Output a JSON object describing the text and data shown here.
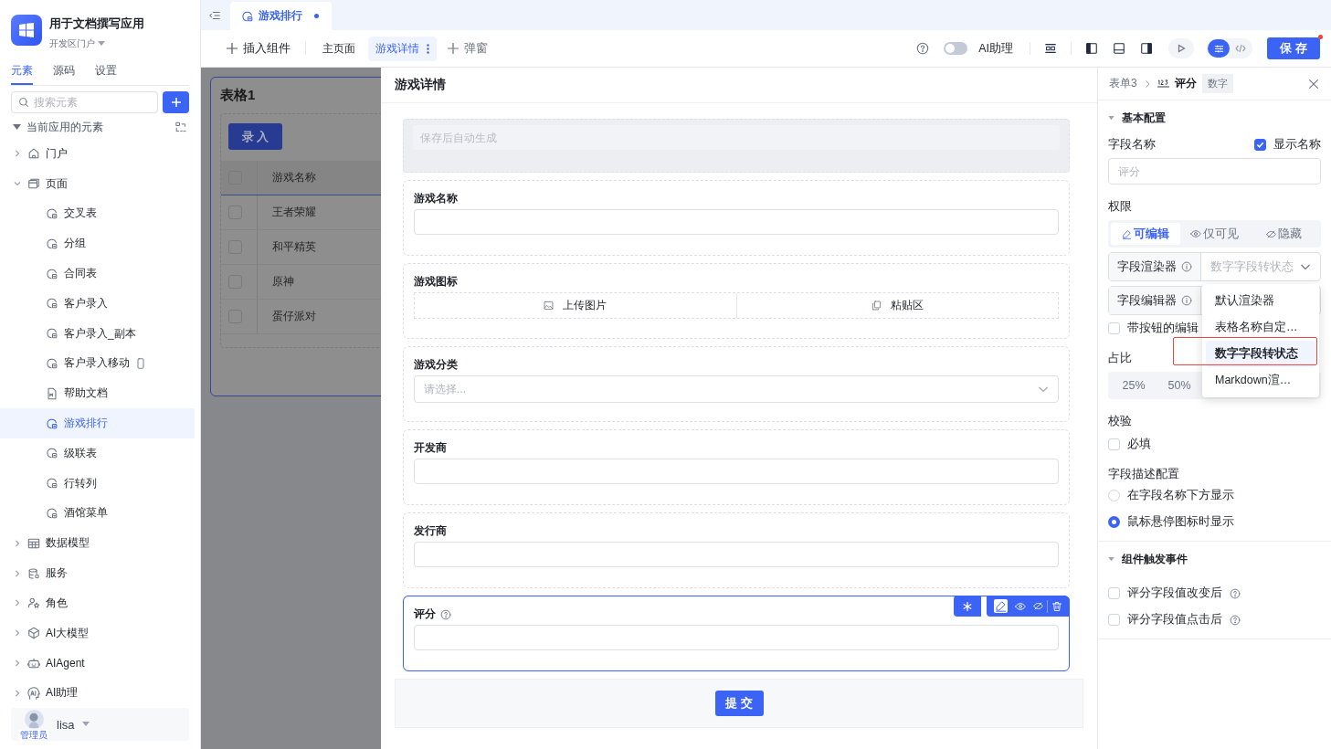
{
  "app": {
    "name": "用于文档撰写应用",
    "portal": "开发区门户"
  },
  "sidebar_tabs": [
    {
      "label": "元素",
      "selected": true
    },
    {
      "label": "源码",
      "selected": false
    },
    {
      "label": "设置",
      "selected": false
    }
  ],
  "search": {
    "placeholder": "搜索元素"
  },
  "tree": {
    "label": "当前应用的元素",
    "expanded": true,
    "children": [
      {
        "label": "门户",
        "kind": "home",
        "expanded": false
      },
      {
        "label": "页面",
        "kind": "page",
        "expanded": true,
        "children": [
          {
            "label": "交叉表",
            "kind": "form",
            "mobile": false,
            "selected": false
          },
          {
            "label": "分组",
            "kind": "form",
            "mobile": false,
            "selected": false
          },
          {
            "label": "合同表",
            "kind": "form",
            "mobile": false,
            "selected": false
          },
          {
            "label": "客户录入",
            "kind": "form",
            "mobile": false,
            "selected": false
          },
          {
            "label": "客户录入_副本",
            "kind": "form",
            "mobile": false,
            "selected": false
          },
          {
            "label": "客户录入移动",
            "kind": "form",
            "mobile": true,
            "selected": false
          },
          {
            "label": "帮助文档",
            "kind": "doc",
            "mobile": false,
            "selected": false
          },
          {
            "label": "游戏排行",
            "kind": "form",
            "mobile": false,
            "selected": true
          },
          {
            "label": "级联表",
            "kind": "form",
            "mobile": false,
            "selected": false
          },
          {
            "label": "行转列",
            "kind": "form",
            "mobile": false,
            "selected": false
          },
          {
            "label": "酒馆菜单",
            "kind": "form",
            "mobile": false,
            "selected": false
          }
        ]
      },
      {
        "label": "数据模型",
        "kind": "table",
        "expanded": false
      },
      {
        "label": "服务",
        "kind": "service",
        "expanded": false
      },
      {
        "label": "角色",
        "kind": "role",
        "expanded": false
      },
      {
        "label": "AI大模型",
        "kind": "model",
        "expanded": false
      },
      {
        "label": "AIAgent",
        "kind": "agent",
        "expanded": false
      },
      {
        "label": "AI助理",
        "kind": "ai",
        "expanded": false
      }
    ]
  },
  "user": {
    "name": "lisa",
    "role": "管理员"
  },
  "editor_tabs": [
    {
      "label": "游戏排行",
      "modified": true,
      "selected": true
    }
  ],
  "toolbar": {
    "insert": "插入组件",
    "pages": [
      {
        "label": "主页面",
        "selected": false
      },
      {
        "label": "游戏详情",
        "selected": true
      }
    ],
    "add_dialog": "弹窗",
    "ai_assistant": {
      "label": "AI助理",
      "on": false
    },
    "save": "保 存"
  },
  "background_table": {
    "title": "表格1",
    "button": "录 入",
    "column": "游戏名称",
    "all_checked": false,
    "rows": [
      {
        "name": "王者荣耀",
        "checked": false
      },
      {
        "name": "和平精英",
        "checked": false
      },
      {
        "name": "原神",
        "checked": false
      },
      {
        "name": "蛋仔派对",
        "checked": false
      }
    ]
  },
  "drawer": {
    "title": "游戏详情",
    "auto_id": {
      "placeholder": "保存后自动生成"
    },
    "fields": [
      {
        "kind": "text",
        "label": "游戏名称",
        "help": false,
        "selected": false
      },
      {
        "kind": "upload",
        "label": "游戏图标",
        "help": false,
        "selected": false,
        "actions": [
          "上传图片",
          "粘贴区"
        ]
      },
      {
        "kind": "select",
        "label": "游戏分类",
        "help": false,
        "selected": false,
        "placeholder": "请选择..."
      },
      {
        "kind": "text",
        "label": "开发商",
        "help": false,
        "selected": false
      },
      {
        "kind": "text",
        "label": "发行商",
        "help": false,
        "selected": false
      },
      {
        "kind": "text",
        "label": "评分",
        "help": true,
        "selected": true
      }
    ],
    "submit": "提 交"
  },
  "props": {
    "breadcrumb": [
      "表单3",
      "评分"
    ],
    "type_badge": "数字",
    "basic": {
      "title": "基本配置",
      "expanded": true,
      "field_name": {
        "label": "字段名称",
        "placeholder": "评分"
      },
      "show_name": {
        "label": "显示名称",
        "checked": true
      },
      "permission": {
        "label": "权限",
        "options": [
          {
            "label": "可编辑",
            "kind": "edit",
            "selected": true
          },
          {
            "label": "仅可见",
            "kind": "view",
            "selected": false
          },
          {
            "label": "隐藏",
            "kind": "hide",
            "selected": false
          }
        ]
      },
      "renderer": {
        "label": "字段渲染器",
        "value": "数字字段转状态"
      },
      "editor": {
        "label": "字段编辑器"
      },
      "button_editor": {
        "label": "带按钮的编辑",
        "checked": false
      },
      "ratio": {
        "label": "占比",
        "options": [
          {
            "label": "25%",
            "selected": false
          },
          {
            "label": "50%",
            "selected": false
          }
        ]
      },
      "validation": {
        "label": "校验",
        "required": {
          "label": "必填",
          "checked": false
        }
      },
      "description": {
        "label": "字段描述配置",
        "options": [
          {
            "label": "在字段名称下方显示",
            "selected": false
          },
          {
            "label": "鼠标悬停图标时显示",
            "selected": true
          }
        ]
      }
    },
    "events": {
      "title": "组件触发事件",
      "expanded": true,
      "items": [
        {
          "label": "评分字段值改变后",
          "checked": false
        },
        {
          "label": "评分字段值点击后",
          "checked": false
        }
      ]
    },
    "dropdown": {
      "options": [
        {
          "label": "默认渲染器",
          "selected": false
        },
        {
          "label": "表格名称自定…",
          "selected": false
        },
        {
          "label": "数字字段转状态",
          "selected": true
        },
        {
          "label": "Markdown渲…",
          "selected": false
        }
      ]
    }
  }
}
